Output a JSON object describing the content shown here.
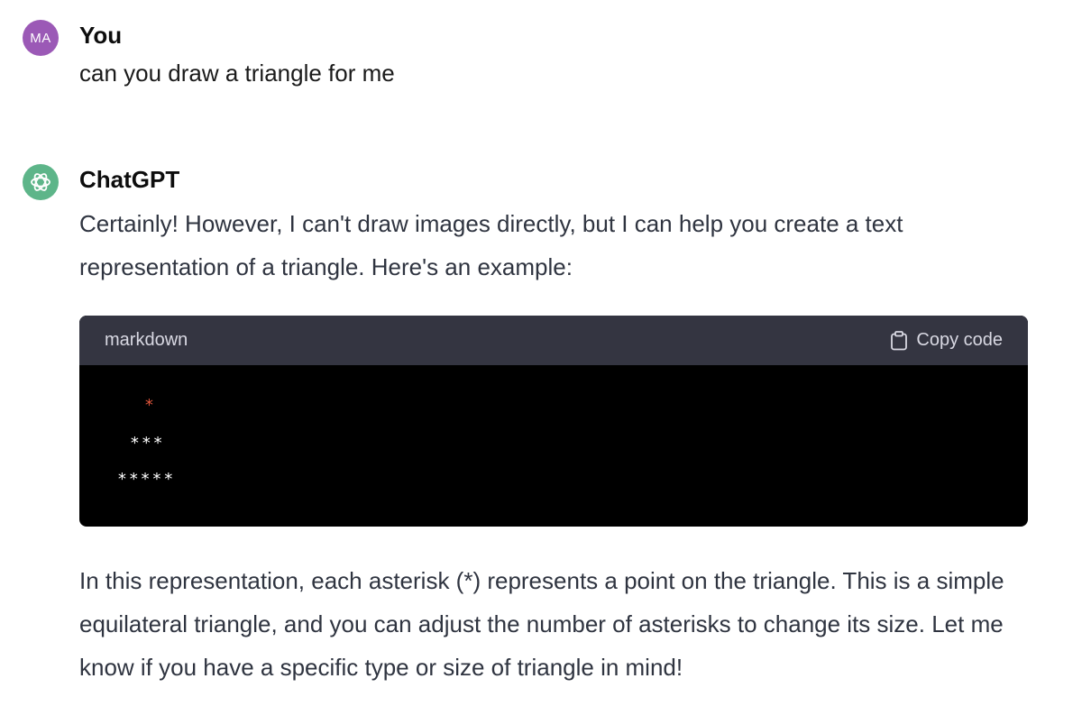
{
  "conversation": {
    "user_message": {
      "avatar_initials": "MA",
      "author": "You",
      "text": "can you draw a triangle for me"
    },
    "assistant_message": {
      "avatar_icon": "openai-logo-icon",
      "author": "ChatGPT",
      "intro": "Certainly! However, I can't draw images directly, but I can help you create a text representation of a triangle. Here's an example:",
      "code_block": {
        "language": "markdown",
        "copy_label": "Copy code",
        "copy_icon": "clipboard-icon",
        "lines": [
          "*",
          "***",
          "*****"
        ]
      },
      "outro": "In this representation, each asterisk (*) represents a point on the triangle. This is a simple equilateral triangle, and you can adjust the number of asterisks to change its size. Let me know if you have a specific type or size of triangle in mind!"
    }
  },
  "colors": {
    "user_avatar": "#9b59b6",
    "assistant_avatar": "#5db589",
    "code_header_bg": "#343541",
    "code_body_bg": "#000000",
    "first_line_asterisk": "#e0553b"
  }
}
